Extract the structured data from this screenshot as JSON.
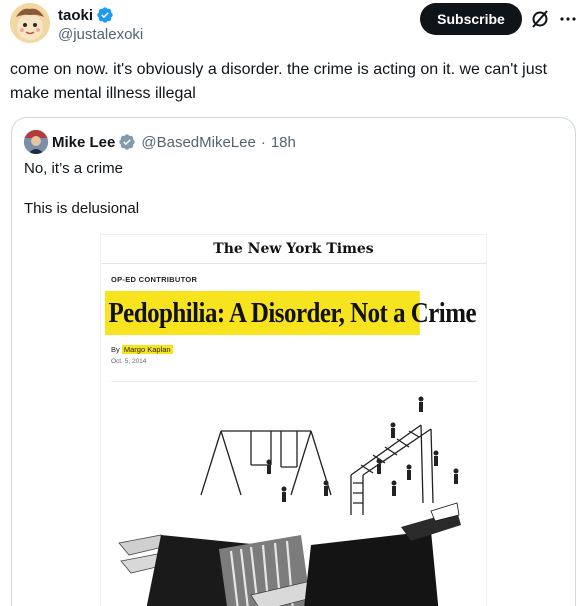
{
  "post": {
    "author_name": "taoki",
    "author_handle": "@justalexoki",
    "subscribe_label": "Subscribe",
    "text": "come on now. it's obviously a disorder. the crime is acting on it. we can't just make mental illness illegal"
  },
  "quote": {
    "author_name": "Mike Lee",
    "author_handle": "@BasedMikeLee",
    "separator": "·",
    "time": "18h",
    "text_line1": "No, it’s a crime",
    "text_line2": "This is delusional"
  },
  "article": {
    "masthead": "The New York Times",
    "section": "OP-ED CONTRIBUTOR",
    "headline": "Pedophilia: A Disorder, Not a Crime",
    "byline_prefix": "By",
    "byline_author": "Margo Kaplan",
    "date": "Oct. 5, 2014"
  },
  "colors": {
    "verified_blue": "#1d9bf0",
    "highlight_yellow": "#f7e41e",
    "button_dark": "#0f1419",
    "muted_text": "#536471",
    "border": "#cfd9de"
  },
  "icons": {
    "verified": "verified-badge-icon",
    "grok": "grok-icon",
    "more": "more-icon"
  }
}
